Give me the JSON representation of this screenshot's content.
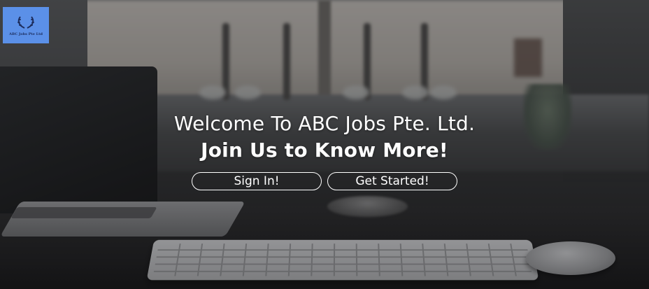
{
  "logo": {
    "text": "ABC Jobs Pte Ltd",
    "background_color": "#5b90e8",
    "icon": "laurel-wreath-icon"
  },
  "hero": {
    "title_line1": "Welcome To ABC Jobs Pte. Ltd.",
    "title_line2": "Join Us to Know More!"
  },
  "buttons": {
    "sign_in": "Sign In!",
    "get_started": "Get Started!"
  }
}
